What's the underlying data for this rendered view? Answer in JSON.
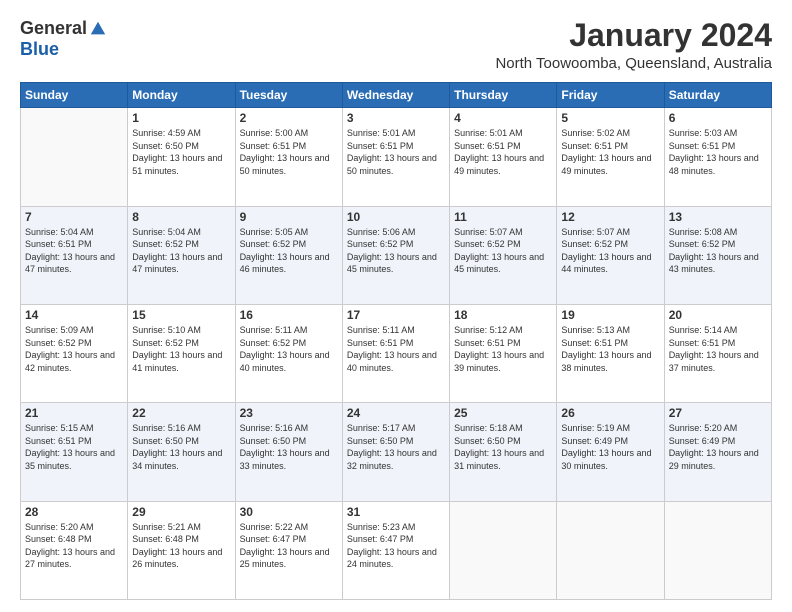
{
  "header": {
    "logo_general": "General",
    "logo_blue": "Blue",
    "title": "January 2024",
    "subtitle": "North Toowoomba, Queensland, Australia"
  },
  "calendar": {
    "days_of_week": [
      "Sunday",
      "Monday",
      "Tuesday",
      "Wednesday",
      "Thursday",
      "Friday",
      "Saturday"
    ],
    "weeks": [
      [
        {
          "day": "",
          "empty": true
        },
        {
          "day": "1",
          "sunrise": "Sunrise: 4:59 AM",
          "sunset": "Sunset: 6:50 PM",
          "daylight": "Daylight: 13 hours and 51 minutes."
        },
        {
          "day": "2",
          "sunrise": "Sunrise: 5:00 AM",
          "sunset": "Sunset: 6:51 PM",
          "daylight": "Daylight: 13 hours and 50 minutes."
        },
        {
          "day": "3",
          "sunrise": "Sunrise: 5:01 AM",
          "sunset": "Sunset: 6:51 PM",
          "daylight": "Daylight: 13 hours and 50 minutes."
        },
        {
          "day": "4",
          "sunrise": "Sunrise: 5:01 AM",
          "sunset": "Sunset: 6:51 PM",
          "daylight": "Daylight: 13 hours and 49 minutes."
        },
        {
          "day": "5",
          "sunrise": "Sunrise: 5:02 AM",
          "sunset": "Sunset: 6:51 PM",
          "daylight": "Daylight: 13 hours and 49 minutes."
        },
        {
          "day": "6",
          "sunrise": "Sunrise: 5:03 AM",
          "sunset": "Sunset: 6:51 PM",
          "daylight": "Daylight: 13 hours and 48 minutes."
        }
      ],
      [
        {
          "day": "7",
          "sunrise": "Sunrise: 5:04 AM",
          "sunset": "Sunset: 6:51 PM",
          "daylight": "Daylight: 13 hours and 47 minutes."
        },
        {
          "day": "8",
          "sunrise": "Sunrise: 5:04 AM",
          "sunset": "Sunset: 6:52 PM",
          "daylight": "Daylight: 13 hours and 47 minutes."
        },
        {
          "day": "9",
          "sunrise": "Sunrise: 5:05 AM",
          "sunset": "Sunset: 6:52 PM",
          "daylight": "Daylight: 13 hours and 46 minutes."
        },
        {
          "day": "10",
          "sunrise": "Sunrise: 5:06 AM",
          "sunset": "Sunset: 6:52 PM",
          "daylight": "Daylight: 13 hours and 45 minutes."
        },
        {
          "day": "11",
          "sunrise": "Sunrise: 5:07 AM",
          "sunset": "Sunset: 6:52 PM",
          "daylight": "Daylight: 13 hours and 45 minutes."
        },
        {
          "day": "12",
          "sunrise": "Sunrise: 5:07 AM",
          "sunset": "Sunset: 6:52 PM",
          "daylight": "Daylight: 13 hours and 44 minutes."
        },
        {
          "day": "13",
          "sunrise": "Sunrise: 5:08 AM",
          "sunset": "Sunset: 6:52 PM",
          "daylight": "Daylight: 13 hours and 43 minutes."
        }
      ],
      [
        {
          "day": "14",
          "sunrise": "Sunrise: 5:09 AM",
          "sunset": "Sunset: 6:52 PM",
          "daylight": "Daylight: 13 hours and 42 minutes."
        },
        {
          "day": "15",
          "sunrise": "Sunrise: 5:10 AM",
          "sunset": "Sunset: 6:52 PM",
          "daylight": "Daylight: 13 hours and 41 minutes."
        },
        {
          "day": "16",
          "sunrise": "Sunrise: 5:11 AM",
          "sunset": "Sunset: 6:52 PM",
          "daylight": "Daylight: 13 hours and 40 minutes."
        },
        {
          "day": "17",
          "sunrise": "Sunrise: 5:11 AM",
          "sunset": "Sunset: 6:51 PM",
          "daylight": "Daylight: 13 hours and 40 minutes."
        },
        {
          "day": "18",
          "sunrise": "Sunrise: 5:12 AM",
          "sunset": "Sunset: 6:51 PM",
          "daylight": "Daylight: 13 hours and 39 minutes."
        },
        {
          "day": "19",
          "sunrise": "Sunrise: 5:13 AM",
          "sunset": "Sunset: 6:51 PM",
          "daylight": "Daylight: 13 hours and 38 minutes."
        },
        {
          "day": "20",
          "sunrise": "Sunrise: 5:14 AM",
          "sunset": "Sunset: 6:51 PM",
          "daylight": "Daylight: 13 hours and 37 minutes."
        }
      ],
      [
        {
          "day": "21",
          "sunrise": "Sunrise: 5:15 AM",
          "sunset": "Sunset: 6:51 PM",
          "daylight": "Daylight: 13 hours and 35 minutes."
        },
        {
          "day": "22",
          "sunrise": "Sunrise: 5:16 AM",
          "sunset": "Sunset: 6:50 PM",
          "daylight": "Daylight: 13 hours and 34 minutes."
        },
        {
          "day": "23",
          "sunrise": "Sunrise: 5:16 AM",
          "sunset": "Sunset: 6:50 PM",
          "daylight": "Daylight: 13 hours and 33 minutes."
        },
        {
          "day": "24",
          "sunrise": "Sunrise: 5:17 AM",
          "sunset": "Sunset: 6:50 PM",
          "daylight": "Daylight: 13 hours and 32 minutes."
        },
        {
          "day": "25",
          "sunrise": "Sunrise: 5:18 AM",
          "sunset": "Sunset: 6:50 PM",
          "daylight": "Daylight: 13 hours and 31 minutes."
        },
        {
          "day": "26",
          "sunrise": "Sunrise: 5:19 AM",
          "sunset": "Sunset: 6:49 PM",
          "daylight": "Daylight: 13 hours and 30 minutes."
        },
        {
          "day": "27",
          "sunrise": "Sunrise: 5:20 AM",
          "sunset": "Sunset: 6:49 PM",
          "daylight": "Daylight: 13 hours and 29 minutes."
        }
      ],
      [
        {
          "day": "28",
          "sunrise": "Sunrise: 5:20 AM",
          "sunset": "Sunset: 6:48 PM",
          "daylight": "Daylight: 13 hours and 27 minutes."
        },
        {
          "day": "29",
          "sunrise": "Sunrise: 5:21 AM",
          "sunset": "Sunset: 6:48 PM",
          "daylight": "Daylight: 13 hours and 26 minutes."
        },
        {
          "day": "30",
          "sunrise": "Sunrise: 5:22 AM",
          "sunset": "Sunset: 6:47 PM",
          "daylight": "Daylight: 13 hours and 25 minutes."
        },
        {
          "day": "31",
          "sunrise": "Sunrise: 5:23 AM",
          "sunset": "Sunset: 6:47 PM",
          "daylight": "Daylight: 13 hours and 24 minutes."
        },
        {
          "day": "",
          "empty": true
        },
        {
          "day": "",
          "empty": true
        },
        {
          "day": "",
          "empty": true
        }
      ]
    ]
  }
}
